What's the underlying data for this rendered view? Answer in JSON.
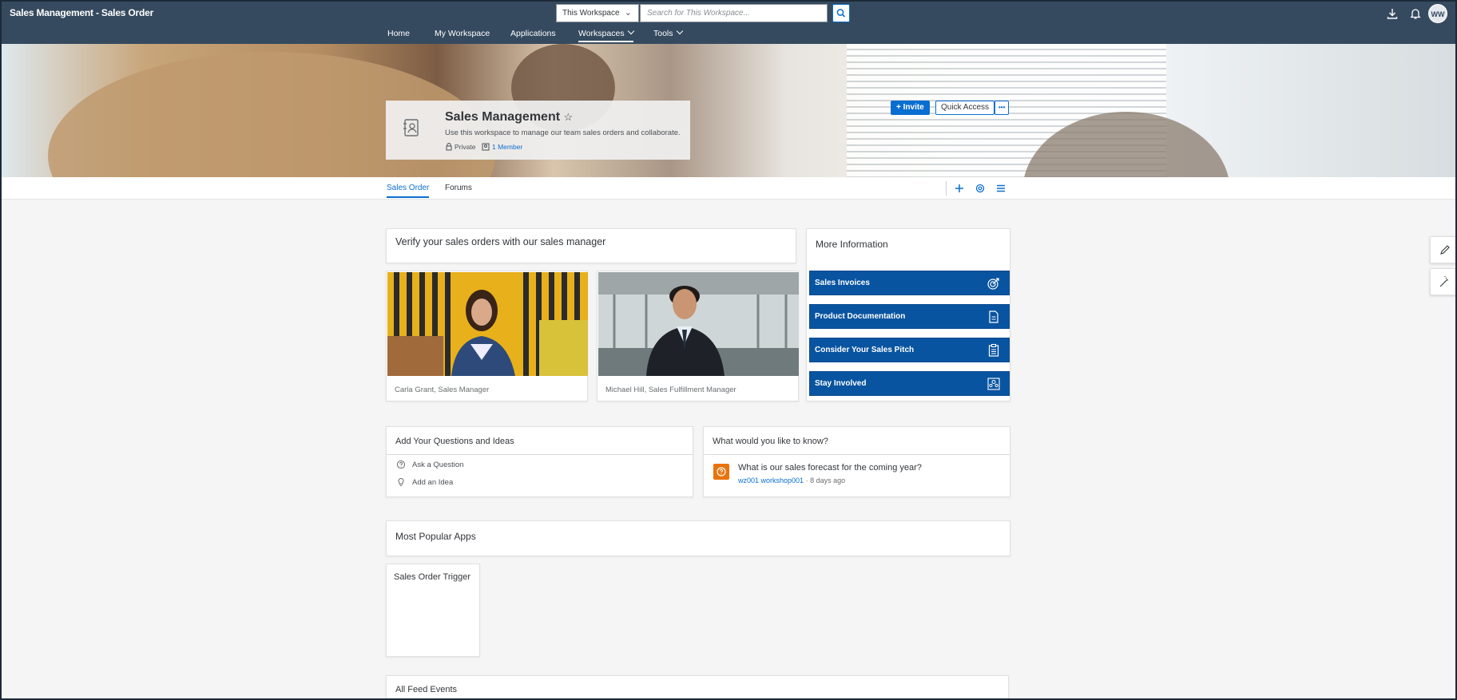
{
  "shell": {
    "title": "Sales Management - Sales Order",
    "scope_value": "This Workspace",
    "search_placeholder": "Search for This Workspace...",
    "avatar_initials": "WW",
    "nav": [
      {
        "label": "Home"
      },
      {
        "label": "My Workspace"
      },
      {
        "label": "Applications"
      },
      {
        "label": "Workspaces"
      },
      {
        "label": "Tools"
      }
    ]
  },
  "hero": {
    "invite_label": "Invite",
    "quick_access_label": "Quick Access",
    "more_label": "•••",
    "workspace": {
      "title": "Sales Management",
      "description": "Use this workspace to manage our team sales orders and collaborate.",
      "privacy": "Private",
      "members": "1 Member"
    }
  },
  "tabs": [
    {
      "label": "Sales Order"
    },
    {
      "label": "Forums"
    }
  ],
  "content": {
    "verify_title": "Verify your sales orders with our sales manager",
    "people": [
      {
        "caption": "Carla Grant, Sales Manager"
      },
      {
        "caption": "Michael Hill, Sales Fulfillment Manager"
      }
    ],
    "more_info": {
      "title": "More Information",
      "items": [
        {
          "label": "Sales Invoices",
          "icon": "target-icon"
        },
        {
          "label": "Product Documentation",
          "icon": "document-icon"
        },
        {
          "label": "Consider Your Sales Pitch",
          "icon": "clipboard-icon"
        },
        {
          "label": "Stay Involved",
          "icon": "group-icon"
        }
      ]
    },
    "questions": {
      "title": "Add Your Questions and Ideas",
      "items": [
        {
          "label": "Ask a Question",
          "icon": "question-icon"
        },
        {
          "label": "Add an Idea",
          "icon": "lightbulb-icon"
        }
      ]
    },
    "know": {
      "title": "What would you like to know?",
      "question": "What is our sales forecast for the coming year?",
      "author": "wz001 workshop001",
      "time": "· 8 days ago"
    },
    "popular_apps_title": "Most Popular Apps",
    "apps": [
      {
        "label": "Sales Order Trigger"
      }
    ],
    "feed_title": "All Feed Events"
  },
  "colors": {
    "shell": "#354a5f",
    "accent": "#0a6ed1",
    "info_button": "#0854a0",
    "question_badge": "#e9730c"
  }
}
